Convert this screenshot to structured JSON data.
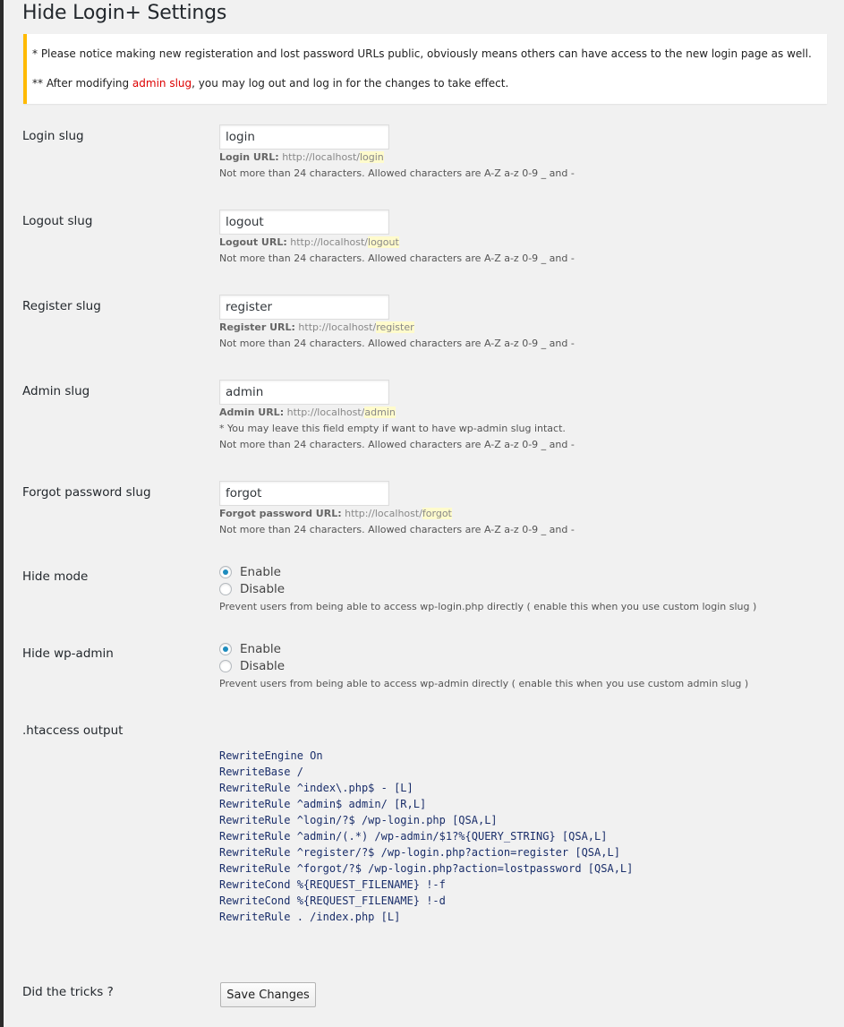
{
  "page": {
    "title": "Hide Login+ Settings"
  },
  "notice": {
    "line1": "* Please notice making new registeration and lost password URLs public, obviously means others can have access to the new login page as well.",
    "line2_prefix": "** After modifying ",
    "line2_highlight": "admin slug",
    "line2_suffix": ", you may log out and log in for the changes to take effect."
  },
  "fields": {
    "login": {
      "label": "Login slug",
      "value": "login",
      "url_label": "Login URL:",
      "url_base": "http://localhost/",
      "slug": "login",
      "hint": "Not more than 24 characters. Allowed characters are A-Z a-z 0-9 _ and -"
    },
    "logout": {
      "label": "Logout slug",
      "value": "logout",
      "url_label": "Logout URL:",
      "url_base": "http://localhost/",
      "slug": "logout",
      "hint": "Not more than 24 characters. Allowed characters are A-Z a-z 0-9 _ and -"
    },
    "register": {
      "label": "Register slug",
      "value": "register",
      "url_label": "Register URL:",
      "url_base": "http://localhost/",
      "slug": "register",
      "hint": "Not more than 24 characters. Allowed characters are A-Z a-z 0-9 _ and -"
    },
    "admin": {
      "label": "Admin slug",
      "value": "admin",
      "url_label": "Admin URL:",
      "url_base": "http://localhost/",
      "slug": "admin",
      "note": "* You may leave this field empty if want to have wp-admin slug intact.",
      "hint": "Not more than 24 characters. Allowed characters are A-Z a-z 0-9 _ and -"
    },
    "forgot": {
      "label": "Forgot password slug",
      "value": "forgot",
      "url_label": "Forgot password URL:",
      "url_base": "http://localhost/",
      "slug": "forgot",
      "hint": "Not more than 24 characters. Allowed characters are A-Z a-z 0-9 _ and -"
    }
  },
  "hide_mode": {
    "label": "Hide mode",
    "options": [
      "Enable",
      "Disable"
    ],
    "selected": "Enable",
    "hint": "Prevent users from being able to access wp-login.php directly ( enable this when you use custom login slug )"
  },
  "hide_wp_admin": {
    "label": "Hide wp-admin",
    "options": [
      "Enable",
      "Disable"
    ],
    "selected": "Enable",
    "hint": "Prevent users from being able to access wp-admin directly ( enable this when you use custom admin slug )"
  },
  "htaccess": {
    "label": ".htaccess output",
    "content": "RewriteEngine On\nRewriteBase /\nRewriteRule ^index\\.php$ - [L]\nRewriteRule ^admin$ admin/ [R,L]\nRewriteRule ^login/?$ /wp-login.php [QSA,L]\nRewriteRule ^admin/(.*) /wp-admin/$1?%{QUERY_STRING} [QSA,L]\nRewriteRule ^register/?$ /wp-login.php?action=register [QSA,L]\nRewriteRule ^forgot/?$ /wp-login.php?action=lostpassword [QSA,L]\nRewriteCond %{REQUEST_FILENAME} !-f\nRewriteCond %{REQUEST_FILENAME} !-d\nRewriteRule . /index.php [L]"
  },
  "submit": {
    "label": "Did the tricks ?",
    "button": "Save Changes"
  },
  "colors": {
    "notice_border": "#ffba00",
    "highlight_red": "#dd0000",
    "radio_dot": "#1e8cbe",
    "slug_highlight": "#fffbcc"
  }
}
